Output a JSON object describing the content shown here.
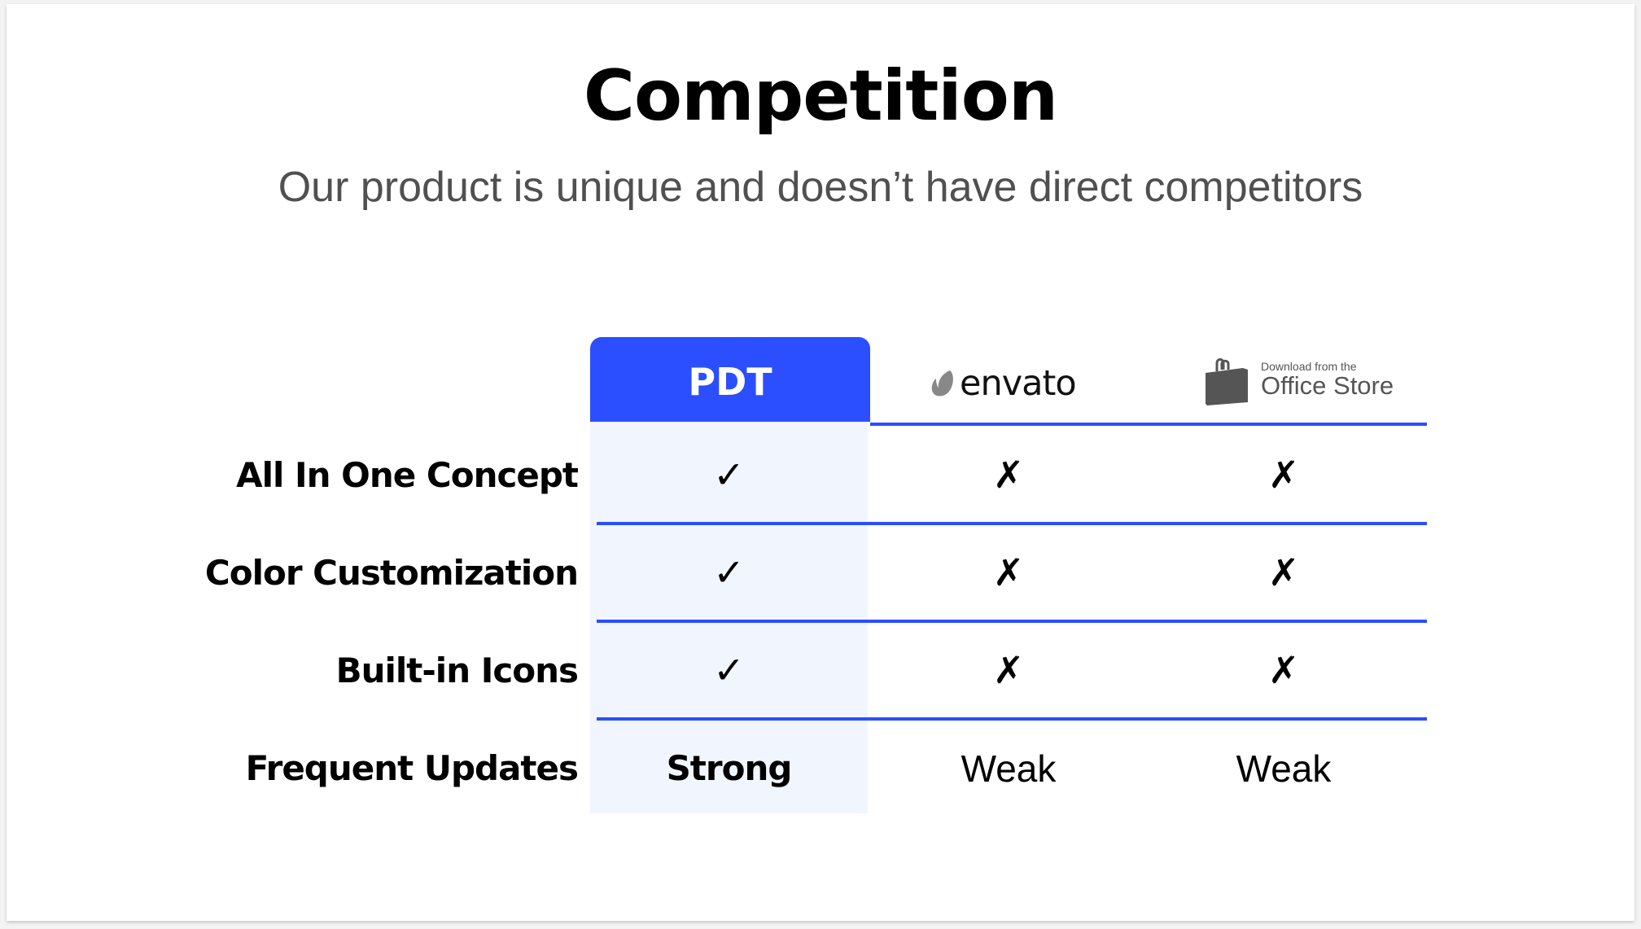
{
  "slide": {
    "title": "Competition",
    "subtitle": "Our product is unique and doesn’t have direct competitors"
  },
  "colors": {
    "accent": "#2b4eff",
    "highlight_column": "#f1f5fe",
    "subtitle_text": "#505050",
    "logo_gray": "#555555"
  },
  "table": {
    "columns": [
      {
        "label": "PDT",
        "type": "text-header"
      },
      {
        "label": "envato",
        "type": "logo",
        "icon": "envato-leaf-icon"
      },
      {
        "label": "Office Store",
        "caption": "Download from the",
        "type": "logo",
        "icon": "shopping-bag-icon"
      }
    ],
    "rows": [
      {
        "label": "All In One Concept",
        "values": [
          "✓",
          "✗",
          "✗"
        ]
      },
      {
        "label": "Color Customization",
        "values": [
          "✓",
          "✗",
          "✗"
        ]
      },
      {
        "label": "Built-in Icons",
        "values": [
          "✓",
          "✗",
          "✗"
        ]
      },
      {
        "label": "Frequent Updates",
        "values": [
          "Strong",
          "Weak",
          "Weak"
        ]
      }
    ]
  }
}
